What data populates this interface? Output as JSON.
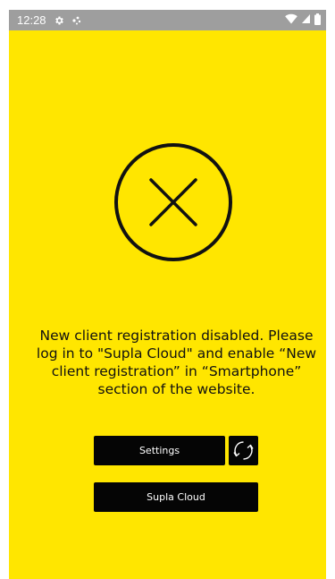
{
  "status_bar": {
    "time": "12:28",
    "left_icons": [
      "gear-icon",
      "notification-dots-icon"
    ],
    "right_icons": [
      "wifi-icon",
      "signal-icon",
      "battery-icon"
    ],
    "background": "#9e9e9e"
  },
  "screen": {
    "background": "#FFE600",
    "status_icon": "error-x-circle-icon",
    "message": "New client registration disabled. Please log in to \"Supla Cloud\" and enable “New client registration” in “Smartphone” section of the website."
  },
  "buttons": {
    "settings_label": "Settings",
    "refresh_icon": "refresh-icon",
    "supla_cloud_label": "Supla Cloud"
  }
}
